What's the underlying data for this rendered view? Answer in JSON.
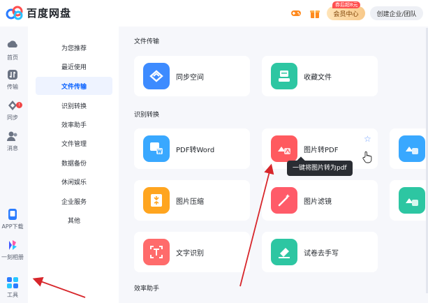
{
  "app": {
    "title": "百度网盘"
  },
  "header": {
    "vip_label": "会员中心",
    "vip_badge": "券后超8元",
    "enterprise_label": "创建企业/团队"
  },
  "rail": {
    "items": [
      {
        "label": "首页",
        "icon": "home-icon"
      },
      {
        "label": "传输",
        "icon": "transfer-icon"
      },
      {
        "label": "同步",
        "icon": "sync-icon",
        "badge": "!"
      },
      {
        "label": "消息",
        "icon": "message-icon"
      },
      {
        "label": "APP下载",
        "icon": "app-download-icon"
      },
      {
        "label": "一刻相册",
        "icon": "album-icon"
      },
      {
        "label": "工具",
        "icon": "tools-icon"
      }
    ]
  },
  "categories": [
    {
      "label": "为您推荐"
    },
    {
      "label": "最近使用"
    },
    {
      "label": "文件传输",
      "active": true
    },
    {
      "label": "识别转换"
    },
    {
      "label": "效率助手"
    },
    {
      "label": "文件管理"
    },
    {
      "label": "数据备份"
    },
    {
      "label": "休闲娱乐"
    },
    {
      "label": "企业服务"
    },
    {
      "label": "其他"
    }
  ],
  "sections": {
    "file_transfer": {
      "title": "文件传输",
      "cards": [
        {
          "label": "同步空间",
          "color": "#3d8bff"
        },
        {
          "label": "收藏文件",
          "color": "#2dc6a2"
        }
      ]
    },
    "recognition": {
      "title": "识别转换",
      "cards": [
        {
          "label": "PDF转Word",
          "color": "#39a8ff"
        },
        {
          "label": "图片转PDF",
          "color": "#ff5a5f"
        },
        {
          "label": "图片压缩",
          "color": "#ffa51f"
        },
        {
          "label": "图片滤镜",
          "color": "#ff5b69"
        },
        {
          "label": "文字识别",
          "color": "#ff6b6b"
        },
        {
          "label": "试卷去手写",
          "color": "#2dc6a2"
        }
      ]
    },
    "efficiency": {
      "title": "效率助手"
    }
  },
  "tooltip": {
    "text": "一键将图片转为pdf"
  },
  "colors": {
    "accent": "#0a62ff",
    "annotation": "#d7262b"
  }
}
